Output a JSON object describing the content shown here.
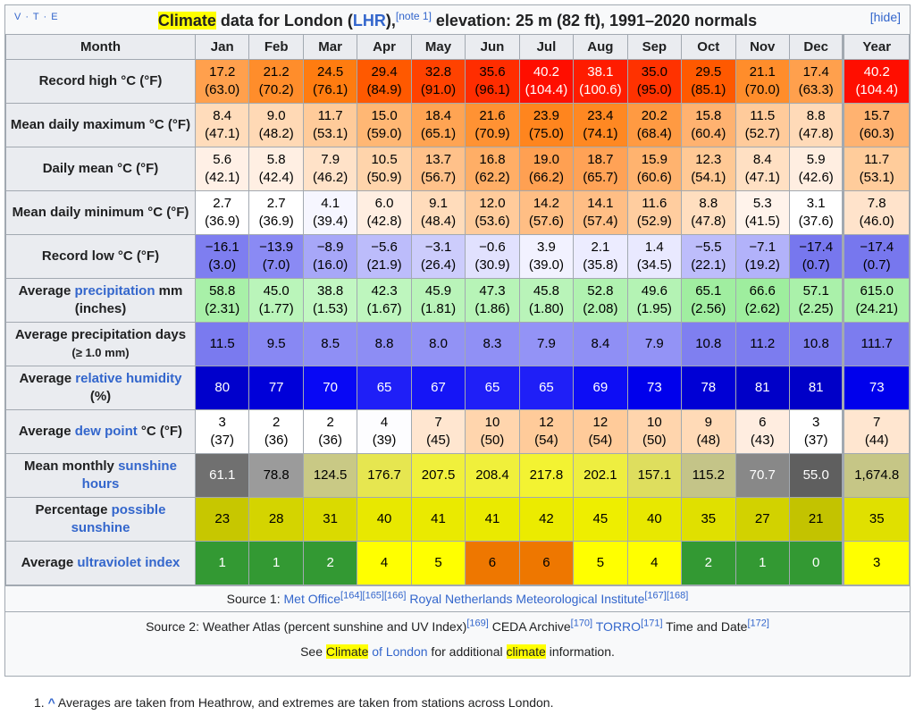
{
  "caption": {
    "vte": [
      "V",
      "T",
      "E"
    ],
    "hide": "[hide]",
    "title_hl": "Climate",
    "title_mid": " data for London (",
    "title_link": "LHR",
    "title_close": "),",
    "note_ref": "[note 1]",
    "title_end": " elevation: 25 m (82 ft), 1991–2020 normals"
  },
  "header": [
    "Month",
    "Jan",
    "Feb",
    "Mar",
    "Apr",
    "May",
    "Jun",
    "Jul",
    "Aug",
    "Sep",
    "Oct",
    "Nov",
    "Dec",
    "Year"
  ],
  "rows": [
    {
      "label_parts": [
        {
          "t": "Record high °C (°F)"
        }
      ],
      "values": [
        "17.2\n(63.0)",
        "21.2\n(70.2)",
        "24.5\n(76.1)",
        "29.4\n(84.9)",
        "32.8\n(91.0)",
        "35.6\n(96.1)",
        "40.2\n(104.4)",
        "38.1\n(100.6)",
        "35.0\n(95.0)",
        "29.5\n(85.1)",
        "21.1\n(70.0)",
        "17.4\n(63.3)",
        "40.2\n(104.4)"
      ],
      "bg": [
        "#ffa04d",
        "#ff8d2b",
        "#ff7c10",
        "#ff5900",
        "#ff4200",
        "#ff2d00",
        "#ff0e00",
        "#ff1c00",
        "#ff3200",
        "#ff5900",
        "#ff8d2b",
        "#ffa04d",
        "#ff0e00"
      ],
      "fg": [
        "#000",
        "#000",
        "#000",
        "#000",
        "#000",
        "#000",
        "#fff",
        "#fff",
        "#000",
        "#000",
        "#000",
        "#000",
        "#fff"
      ]
    },
    {
      "label_parts": [
        {
          "t": "Mean daily maximum °C (°F)"
        }
      ],
      "values": [
        "8.4\n(47.1)",
        "9.0\n(48.2)",
        "11.7\n(53.1)",
        "15.0\n(59.0)",
        "18.4\n(65.1)",
        "21.6\n(70.9)",
        "23.9\n(75.0)",
        "23.4\n(74.1)",
        "20.2\n(68.4)",
        "15.8\n(60.4)",
        "11.5\n(52.7)",
        "8.8\n(47.8)",
        "15.7\n(60.3)"
      ],
      "bg": [
        "#ffdcbb",
        "#ffd9b5",
        "#ffcb9a",
        "#ffb774",
        "#ffa453",
        "#ff9233",
        "#ff851e",
        "#ff8822",
        "#ff9a42",
        "#ffb270",
        "#ffcb9b",
        "#ffdab8",
        "#ffb270"
      ],
      "fg": [
        "#000",
        "#000",
        "#000",
        "#000",
        "#000",
        "#000",
        "#000",
        "#000",
        "#000",
        "#000",
        "#000",
        "#000",
        "#000"
      ]
    },
    {
      "label_parts": [
        {
          "t": "Daily mean °C (°F)"
        }
      ],
      "values": [
        "5.6\n(42.1)",
        "5.8\n(42.4)",
        "7.9\n(46.2)",
        "10.5\n(50.9)",
        "13.7\n(56.7)",
        "16.8\n(62.2)",
        "19.0\n(66.2)",
        "18.7\n(65.7)",
        "15.9\n(60.6)",
        "12.3\n(54.1)",
        "8.4\n(47.1)",
        "5.9\n(42.6)",
        "11.7\n(53.1)"
      ],
      "bg": [
        "#fff0e6",
        "#ffefe3",
        "#ffe2c8",
        "#ffd4ab",
        "#ffc18a",
        "#ffae66",
        "#ffa052",
        "#ffa256",
        "#ffb36f",
        "#ffc995",
        "#ffe0c3",
        "#ffeee1",
        "#ffcc9b"
      ],
      "fg": [
        "#000",
        "#000",
        "#000",
        "#000",
        "#000",
        "#000",
        "#000",
        "#000",
        "#000",
        "#000",
        "#000",
        "#000",
        "#000"
      ]
    },
    {
      "label_parts": [
        {
          "t": "Mean daily minimum °C (°F)"
        }
      ],
      "values": [
        "2.7\n(36.9)",
        "2.7\n(36.9)",
        "4.1\n(39.4)",
        "6.0\n(42.8)",
        "9.1\n(48.4)",
        "12.0\n(53.6)",
        "14.2\n(57.6)",
        "14.1\n(57.4)",
        "11.6\n(52.9)",
        "8.8\n(47.8)",
        "5.3\n(41.5)",
        "3.1\n(37.6)",
        "7.8\n(46.0)"
      ],
      "bg": [
        "#ffffff",
        "#ffffff",
        "#f6f6ff",
        "#ffeee1",
        "#ffdcbb",
        "#ffcb9b",
        "#ffbe84",
        "#ffbe85",
        "#ffcd9f",
        "#ffdebf",
        "#fff3eb",
        "#ffffff",
        "#ffe3cb"
      ],
      "fg": [
        "#000",
        "#000",
        "#000",
        "#000",
        "#000",
        "#000",
        "#000",
        "#000",
        "#000",
        "#000",
        "#000",
        "#000",
        "#000"
      ]
    },
    {
      "label_parts": [
        {
          "t": "Record low °C (°F)"
        }
      ],
      "values": [
        "−16.1\n(3.0)",
        "−13.9\n(7.0)",
        "−8.9\n(16.0)",
        "−5.6\n(21.9)",
        "−3.1\n(26.4)",
        "−0.6\n(30.9)",
        "3.9\n(39.0)",
        "2.1\n(35.8)",
        "1.4\n(34.5)",
        "−5.5\n(22.1)",
        "−7.1\n(19.2)",
        "−17.4\n(0.7)",
        "−17.4\n(0.7)"
      ],
      "bg": [
        "#7e7ef0",
        "#8a8af4",
        "#a7a7f8",
        "#bcbcfb",
        "#ccccfc",
        "#e1e1fe",
        "#f2f2ff",
        "#ececff",
        "#e9e9ff",
        "#bdbdfb",
        "#b2b2fa",
        "#7777ee",
        "#7777ee"
      ],
      "fg": [
        "#000",
        "#000",
        "#000",
        "#000",
        "#000",
        "#000",
        "#000",
        "#000",
        "#000",
        "#000",
        "#000",
        "#000",
        "#000"
      ]
    },
    {
      "label_parts": [
        {
          "t": "Average "
        },
        {
          "t": "precipitation",
          "link": true
        },
        {
          "t": " mm (inches)"
        }
      ],
      "values": [
        "58.8\n(2.31)",
        "45.0\n(1.77)",
        "38.8\n(1.53)",
        "42.3\n(1.67)",
        "45.9\n(1.81)",
        "47.3\n(1.86)",
        "45.8\n(1.80)",
        "52.8\n(2.08)",
        "49.6\n(1.95)",
        "65.1\n(2.56)",
        "66.6\n(2.62)",
        "57.1\n(2.25)",
        "615.0\n(24.21)"
      ],
      "bg": [
        "#a8f0a8",
        "#baf5ba",
        "#c2f7c2",
        "#bef6be",
        "#b9f4b9",
        "#b7f4b7",
        "#b9f4b9",
        "#b0f2b0",
        "#b4f3b4",
        "#a0eea0",
        "#9eee9e",
        "#aaf1aa",
        "#a8f0a8"
      ],
      "fg": [
        "#000",
        "#000",
        "#000",
        "#000",
        "#000",
        "#000",
        "#000",
        "#000",
        "#000",
        "#000",
        "#000",
        "#000",
        "#000"
      ]
    },
    {
      "label_parts": [
        {
          "t": "Average precipitation days "
        },
        {
          "t": "(≥ 1.0 mm)",
          "small": true
        }
      ],
      "values": [
        "11.5",
        "9.5",
        "8.5",
        "8.8",
        "8.0",
        "8.3",
        "7.9",
        "8.4",
        "7.9",
        "10.8",
        "11.2",
        "10.8",
        "111.7"
      ],
      "bg": [
        "#7a7aef",
        "#8888f3",
        "#8f8ff5",
        "#8d8df4",
        "#9292f5",
        "#9090f5",
        "#9393f6",
        "#8f8ff5",
        "#9393f6",
        "#7f7ff0",
        "#7c7cef",
        "#7f7ff0",
        "#7c7cef"
      ],
      "fg": [
        "#000",
        "#000",
        "#000",
        "#000",
        "#000",
        "#000",
        "#000",
        "#000",
        "#000",
        "#000",
        "#000",
        "#000",
        "#000"
      ]
    },
    {
      "label_parts": [
        {
          "t": "Average "
        },
        {
          "t": "relative humidity",
          "link": true
        },
        {
          "t": " (%)"
        }
      ],
      "values": [
        "80",
        "77",
        "70",
        "65",
        "67",
        "65",
        "65",
        "69",
        "73",
        "78",
        "81",
        "81",
        "73"
      ],
      "bg": [
        "#0000cc",
        "#0000d9",
        "#0808f5",
        "#1f1ff7",
        "#1515f6",
        "#1f1ff7",
        "#1f1ff7",
        "#0d0df5",
        "#0000ec",
        "#0000d5",
        "#0000c8",
        "#0000c8",
        "#0000ec"
      ],
      "fg": [
        "#fff",
        "#fff",
        "#fff",
        "#fff",
        "#fff",
        "#fff",
        "#fff",
        "#fff",
        "#fff",
        "#fff",
        "#fff",
        "#fff",
        "#fff"
      ]
    },
    {
      "label_parts": [
        {
          "t": "Average "
        },
        {
          "t": "dew point",
          "link": true
        },
        {
          "t": " °C (°F)"
        }
      ],
      "values": [
        "3\n(37)",
        "2\n(36)",
        "2\n(36)",
        "4\n(39)",
        "7\n(45)",
        "10\n(50)",
        "12\n(54)",
        "12\n(54)",
        "10\n(50)",
        "9\n(48)",
        "6\n(43)",
        "3\n(37)",
        "7\n(44)"
      ],
      "bg": [
        "#ffffff",
        "#ffffff",
        "#ffffff",
        "#fdfdff",
        "#ffe6d0",
        "#ffd5ad",
        "#ffcb9a",
        "#ffcb9a",
        "#ffd5ad",
        "#ffdab7",
        "#ffede0",
        "#ffffff",
        "#ffe6d0"
      ],
      "fg": [
        "#000",
        "#000",
        "#000",
        "#000",
        "#000",
        "#000",
        "#000",
        "#000",
        "#000",
        "#000",
        "#000",
        "#000",
        "#000"
      ]
    },
    {
      "label_parts": [
        {
          "t": "Mean monthly "
        },
        {
          "t": "sunshine hours",
          "link": true
        }
      ],
      "values": [
        "61.1",
        "78.8",
        "124.5",
        "176.7",
        "207.5",
        "208.4",
        "217.8",
        "202.1",
        "157.1",
        "115.2",
        "70.7",
        "55.0",
        "1,674.8"
      ],
      "bg": [
        "#707070",
        "#9b9b9b",
        "#c9c985",
        "#e6e650",
        "#f0f03c",
        "#f0f03b",
        "#f3f332",
        "#eeee40",
        "#dede5e",
        "#c4c488",
        "#888888",
        "#5f5f5f",
        "#c6c686"
      ],
      "fg": [
        "#fff",
        "#000",
        "#000",
        "#000",
        "#000",
        "#000",
        "#000",
        "#000",
        "#000",
        "#000",
        "#fff",
        "#fff",
        "#000"
      ]
    },
    {
      "label_parts": [
        {
          "t": "Percentage "
        },
        {
          "t": "possible sunshine",
          "link": true
        }
      ],
      "values": [
        "23",
        "28",
        "31",
        "40",
        "41",
        "41",
        "42",
        "45",
        "40",
        "35",
        "27",
        "21",
        "35"
      ],
      "bg": [
        "#c7c700",
        "#d4d400",
        "#dada00",
        "#e8e800",
        "#eaea00",
        "#eaea00",
        "#ebeb00",
        "#eeee00",
        "#e8e800",
        "#e0e000",
        "#d2d200",
        "#c3c300",
        "#e0e000"
      ],
      "fg": [
        "#000",
        "#000",
        "#000",
        "#000",
        "#000",
        "#000",
        "#000",
        "#000",
        "#000",
        "#000",
        "#000",
        "#000",
        "#000"
      ]
    },
    {
      "label_parts": [
        {
          "t": "Average "
        },
        {
          "t": "ultraviolet index",
          "link": true
        }
      ],
      "values": [
        "1",
        "1",
        "2",
        "4",
        "5",
        "6",
        "6",
        "5",
        "4",
        "2",
        "1",
        "0",
        "3"
      ],
      "bg": [
        "#339933",
        "#339933",
        "#339933",
        "#ffff00",
        "#ffff00",
        "#ee7700",
        "#ee7700",
        "#ffff00",
        "#ffff00",
        "#339933",
        "#339933",
        "#339933",
        "#ffff00"
      ],
      "fg": [
        "#fff",
        "#fff",
        "#fff",
        "#000",
        "#000",
        "#000",
        "#000",
        "#000",
        "#000",
        "#fff",
        "#fff",
        "#fff",
        "#000"
      ]
    }
  ],
  "source1": [
    {
      "t": "Source 1: "
    },
    {
      "t": "Met Office",
      "link": true
    },
    {
      "t": "[164]",
      "sup": true
    },
    {
      "t": "[165]",
      "sup": true
    },
    {
      "t": "[166]",
      "sup": true
    },
    {
      "t": " "
    },
    {
      "t": "Royal Netherlands Meteorological Institute",
      "link": true
    },
    {
      "t": "[167]",
      "sup": true
    },
    {
      "t": "[168]",
      "sup": true
    }
  ],
  "source2": [
    {
      "t": "Source 2: Weather Atlas (percent sunshine and UV Index)"
    },
    {
      "t": "[169]",
      "sup": true
    },
    {
      "t": " CEDA Archive"
    },
    {
      "t": "[170]",
      "sup": true
    },
    {
      "t": " "
    },
    {
      "t": "TORRO",
      "link": true
    },
    {
      "t": "[171]",
      "sup": true
    },
    {
      "t": " Time and Date"
    },
    {
      "t": "[172]",
      "sup": true
    }
  ],
  "see_also": [
    {
      "t": "See "
    },
    {
      "t": "Climate",
      "hl": true
    },
    {
      "t": " of London",
      "link": true
    },
    {
      "t": " for additional "
    },
    {
      "t": "climate",
      "hl": true
    },
    {
      "t": " information."
    }
  ],
  "footnote": {
    "num": "1.",
    "caret": "^",
    "text": "Averages are taken from Heathrow, and extremes are taken from stations across London."
  }
}
